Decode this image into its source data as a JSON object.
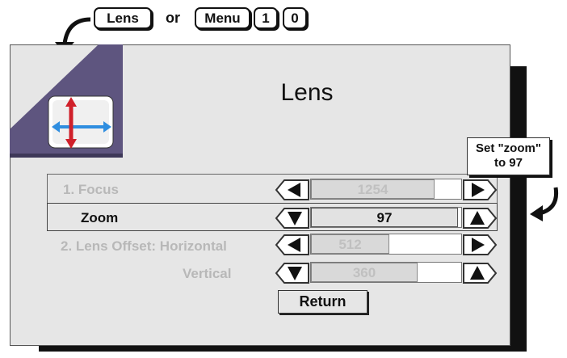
{
  "keys": {
    "lens": "Lens",
    "or": "or",
    "menu": "Menu",
    "digit1": "1",
    "digit2": "0"
  },
  "menu": {
    "title": "Lens",
    "return_label": "Return",
    "rows": [
      {
        "label": "1. Focus",
        "value": "1254",
        "state": "dim",
        "fill_fraction": 0.82
      },
      {
        "label": "Zoom",
        "value": "97",
        "state": "active",
        "fill_fraction": 0.98
      },
      {
        "label": "2. Lens Offset: Horizontal",
        "value": "512",
        "state": "dim",
        "fill_fraction": 0.52
      },
      {
        "label": "Vertical",
        "value": "360",
        "state": "dim",
        "fill_fraction": 0.71
      }
    ]
  },
  "callout": {
    "line1": "Set \"zoom\"",
    "line2": "to 97"
  },
  "colors": {
    "panel": "#e6e6e6",
    "corner_purple": "#5e557f",
    "icon_red": "#d0202a",
    "icon_blue": "#2f8ee0",
    "shadow": "#111111"
  },
  "icons": [
    "curved-arrow-icon",
    "lens-adjust-icon",
    "left-triangle-icon",
    "right-triangle-icon",
    "down-triangle-icon",
    "up-triangle-icon"
  ]
}
